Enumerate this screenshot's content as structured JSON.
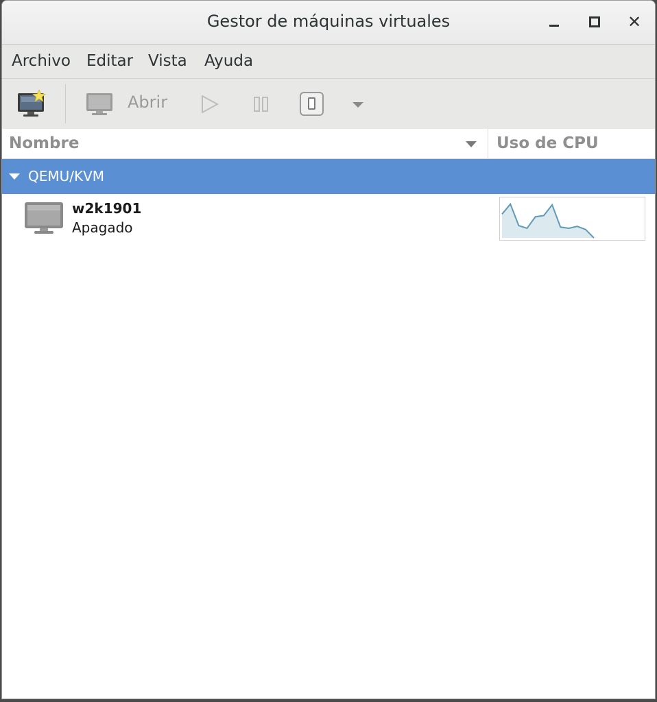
{
  "window": {
    "title": "Gestor de máquinas virtuales"
  },
  "menubar": {
    "items": [
      "Archivo",
      "Editar",
      "Vista",
      "Ayuda"
    ]
  },
  "toolbar": {
    "open_label": "Abrir"
  },
  "columns": {
    "name": "Nombre",
    "cpu": "Uso de CPU"
  },
  "group": {
    "label": "QEMU/KVM"
  },
  "vm": {
    "name": "w2k1901",
    "status": "Apagado",
    "cpu_history": [
      0.62,
      0.88,
      0.32,
      0.25,
      0.55,
      0.58,
      0.86,
      0.28,
      0.25,
      0.3,
      0.22,
      0.0
    ]
  },
  "colors": {
    "selection": "#5b8fd4",
    "graph_line": "#5f9ab5",
    "graph_fill": "#dce9ef"
  },
  "icons": {
    "new_vm": "new-vm-icon",
    "open": "monitor-icon",
    "run": "play-icon",
    "pause": "pause-icon",
    "shutdown": "power-icon",
    "more": "dropdown-arrow-icon"
  }
}
